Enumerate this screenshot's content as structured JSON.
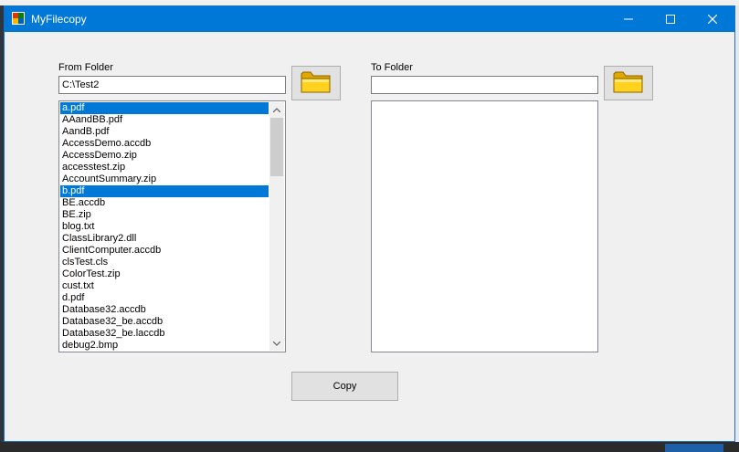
{
  "window": {
    "title": "MyFilecopy"
  },
  "from_folder": {
    "label": "From Folder",
    "path_value": "C:\\Test2"
  },
  "to_folder": {
    "label": "To Folder",
    "path_value": ""
  },
  "file_list": [
    {
      "name": "a.pdf",
      "selected": true
    },
    {
      "name": "AAandBB.pdf",
      "selected": false
    },
    {
      "name": "AandB.pdf",
      "selected": false
    },
    {
      "name": "AccessDemo.accdb",
      "selected": false
    },
    {
      "name": "AccessDemo.zip",
      "selected": false
    },
    {
      "name": "accesstest.zip",
      "selected": false
    },
    {
      "name": "AccountSummary.zip",
      "selected": false
    },
    {
      "name": "b.pdf",
      "selected": true
    },
    {
      "name": "BE.accdb",
      "selected": false
    },
    {
      "name": "BE.zip",
      "selected": false
    },
    {
      "name": "blog.txt",
      "selected": false
    },
    {
      "name": "ClassLibrary2.dll",
      "selected": false
    },
    {
      "name": "ClientComputer.accdb",
      "selected": false
    },
    {
      "name": "clsTest.cls",
      "selected": false
    },
    {
      "name": "ColorTest.zip",
      "selected": false
    },
    {
      "name": "cust.txt",
      "selected": false
    },
    {
      "name": "d.pdf",
      "selected": false
    },
    {
      "name": "Database32.accdb",
      "selected": false
    },
    {
      "name": "Database32_be.accdb",
      "selected": false
    },
    {
      "name": "Database32_be.laccdb",
      "selected": false
    },
    {
      "name": "debug2.bmp",
      "selected": false
    }
  ],
  "buttons": {
    "copy_label": "Copy"
  },
  "icons": {
    "from_browse": "folder-icon",
    "to_browse": "folder-icon",
    "minimize": "minimize-icon",
    "maximize": "maximize-icon",
    "close": "close-icon"
  },
  "colors": {
    "titlebar": "#0078d7",
    "selection": "#0078d7",
    "folder_yellow": "#f5c518"
  }
}
